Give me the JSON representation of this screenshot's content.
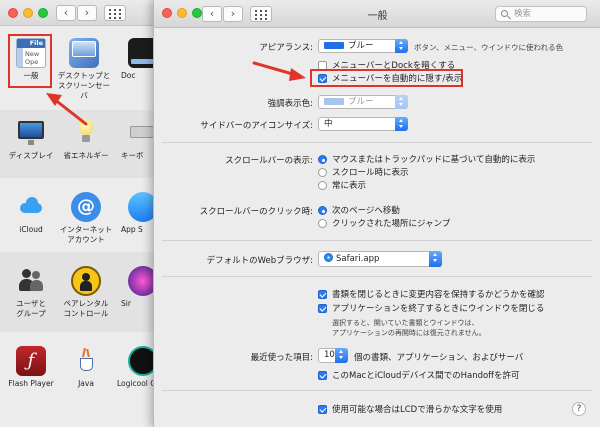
{
  "back_window": {
    "rows": [
      {
        "items": [
          {
            "label": "一般"
          },
          {
            "label": "デスクトップと\nスクリーンセーバ"
          },
          {
            "label": "Doc"
          }
        ]
      },
      {
        "items": [
          {
            "label": "ディスプレイ"
          },
          {
            "label": "省エネルギー"
          },
          {
            "label": "キーボ"
          }
        ]
      },
      {
        "items": [
          {
            "label": "iCloud"
          },
          {
            "label": "インターネット\nアカウント"
          },
          {
            "label": "App S"
          }
        ]
      },
      {
        "items": [
          {
            "label": "ユーザと\nグループ"
          },
          {
            "label": "ペアレンタル\nコントロール"
          },
          {
            "label": "Sir"
          }
        ]
      },
      {
        "items": [
          {
            "label": "Flash Player"
          },
          {
            "label": "Java"
          },
          {
            "label": "Logicool C"
          }
        ]
      }
    ],
    "general_icon_text": {
      "line1": "File",
      "line2": "New",
      "line3": "Ope"
    }
  },
  "window": {
    "title": "一般",
    "search_placeholder": "検索",
    "back_label": "‹",
    "forward_label": "›"
  },
  "appearance": {
    "label": "アピアランス:",
    "value": "ブルー",
    "note": "ボタン、メニュー、ウインドウに使われる色",
    "dock_option": {
      "label": "メニューバーとDockを暗くする",
      "checked": false
    },
    "autohide_option": {
      "label": "メニューバーを自動的に隠す/表示",
      "checked": true
    }
  },
  "highlight": {
    "label": "強調表示色:",
    "value": "ブルー"
  },
  "sidebar_icon_size": {
    "label": "サイドバーのアイコンサイズ:",
    "value": "中"
  },
  "scrollbars": {
    "label": "スクロールバーの表示:",
    "options": [
      {
        "label": "マウスまたはトラックパッドに基づいて自動的に表示",
        "selected": true
      },
      {
        "label": "スクロール時に表示",
        "selected": false
      },
      {
        "label": "常に表示",
        "selected": false
      }
    ]
  },
  "scroll_click": {
    "label": "スクロールバーのクリック時:",
    "options": [
      {
        "label": "次のページへ移動",
        "selected": true
      },
      {
        "label": "クリックされた場所にジャンプ",
        "selected": false
      }
    ]
  },
  "default_browser": {
    "label": "デフォルトのWebブラウザ:",
    "value": "Safari.app"
  },
  "documents": {
    "ask_keep_changes": {
      "label": "書類を閉じるときに変更内容を保持するかどうかを確認",
      "checked": true
    },
    "close_windows": {
      "label": "アプリケーションを終了するときにウインドウを閉じる",
      "checked": true
    },
    "note_line1": "選択すると、開いていた書類とウインドウは、",
    "note_line2": "アプリケーションの再開時には復元されません。"
  },
  "recent_items": {
    "label": "最近使った項目:",
    "value": "10",
    "suffix": "個の書類、アプリケーション、およびサーバ"
  },
  "handoff": {
    "label": "このMacとiCloudデバイス間でのHandoffを許可",
    "checked": true
  },
  "lcd_smoothing": {
    "label": "使用可能な場合はLCDで滑らかな文字を使用",
    "checked": true
  },
  "help_label": "?",
  "colors": {
    "accent": "#2b7bf0",
    "annotation_red": "#e0342a"
  }
}
